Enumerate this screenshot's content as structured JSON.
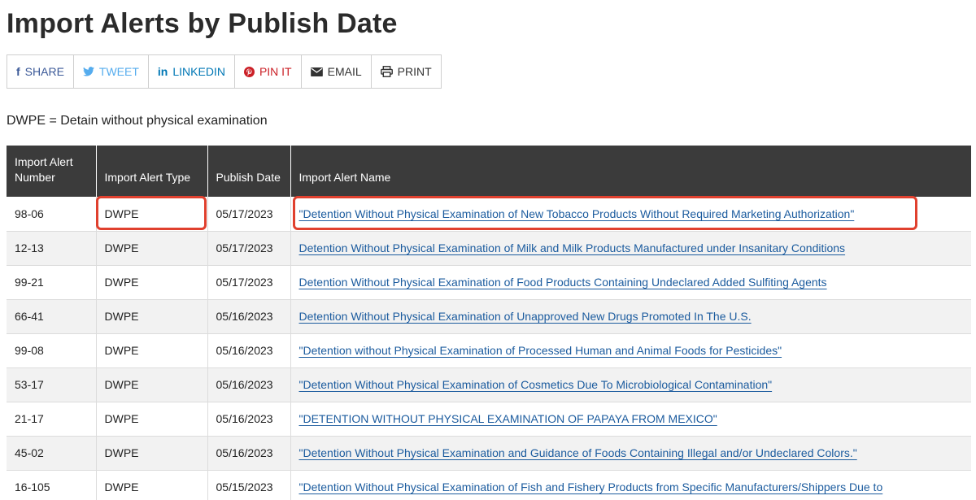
{
  "page": {
    "title": "Import Alerts by Publish Date"
  },
  "share_bar": {
    "items": [
      {
        "label": "SHARE",
        "icon": "facebook-icon",
        "glyph": "f"
      },
      {
        "label": "TWEET",
        "icon": "twitter-icon",
        "glyph": "🐦"
      },
      {
        "label": "LINKEDIN",
        "icon": "linkedin-icon",
        "glyph": "in"
      },
      {
        "label": "PIN IT",
        "icon": "pinterest-icon",
        "glyph": "℗"
      },
      {
        "label": "EMAIL",
        "icon": "envelope-icon",
        "glyph": "✉"
      },
      {
        "label": "PRINT",
        "icon": "printer-icon",
        "glyph": "⎙"
      }
    ]
  },
  "legend_note": "DWPE = Detain without physical examination",
  "table": {
    "headers": {
      "number": "Import Alert Number",
      "type": "Import Alert Type",
      "date": "Publish Date",
      "name": "Import Alert Name"
    },
    "rows": [
      {
        "number": "98-06",
        "type": "DWPE",
        "date": "05/17/2023",
        "name": "\"Detention Without Physical Examination of New Tobacco Products Without Required Marketing Authorization\""
      },
      {
        "number": "12-13",
        "type": "DWPE",
        "date": "05/17/2023",
        "name": "Detention Without Physical Examination of Milk and Milk Products Manufactured under Insanitary Conditions"
      },
      {
        "number": "99-21",
        "type": "DWPE",
        "date": "05/17/2023",
        "name": "Detention Without Physical Examination of Food Products Containing Undeclared Added Sulfiting Agents"
      },
      {
        "number": "66-41",
        "type": "DWPE",
        "date": "05/16/2023",
        "name": "Detention Without Physical Examination of Unapproved New Drugs Promoted In The U.S."
      },
      {
        "number": "99-08",
        "type": "DWPE",
        "date": "05/16/2023",
        "name": "\"Detention without Physical Examination of Processed Human and Animal Foods for Pesticides\""
      },
      {
        "number": "53-17",
        "type": "DWPE",
        "date": "05/16/2023",
        "name": "\"Detention Without Physical Examination of Cosmetics Due To Microbiological Contamination\""
      },
      {
        "number": "21-17",
        "type": "DWPE",
        "date": "05/16/2023",
        "name": "\"DETENTION WITHOUT PHYSICAL EXAMINATION OF PAPAYA FROM MEXICO\""
      },
      {
        "number": "45-02",
        "type": "DWPE",
        "date": "05/16/2023",
        "name": "\"Detention Without Physical Examination and Guidance of Foods Containing Illegal and/or Undeclared Colors.\""
      },
      {
        "number": "16-105",
        "type": "DWPE",
        "date": "05/15/2023",
        "name": "\"Detention Without Physical Examination of Fish and Fishery Products from Specific Manufacturers/Shippers Due to"
      }
    ]
  },
  "colors": {
    "header_bg": "#3b3b3b",
    "link": "#1b5b9e",
    "highlight": "#e0402e"
  }
}
